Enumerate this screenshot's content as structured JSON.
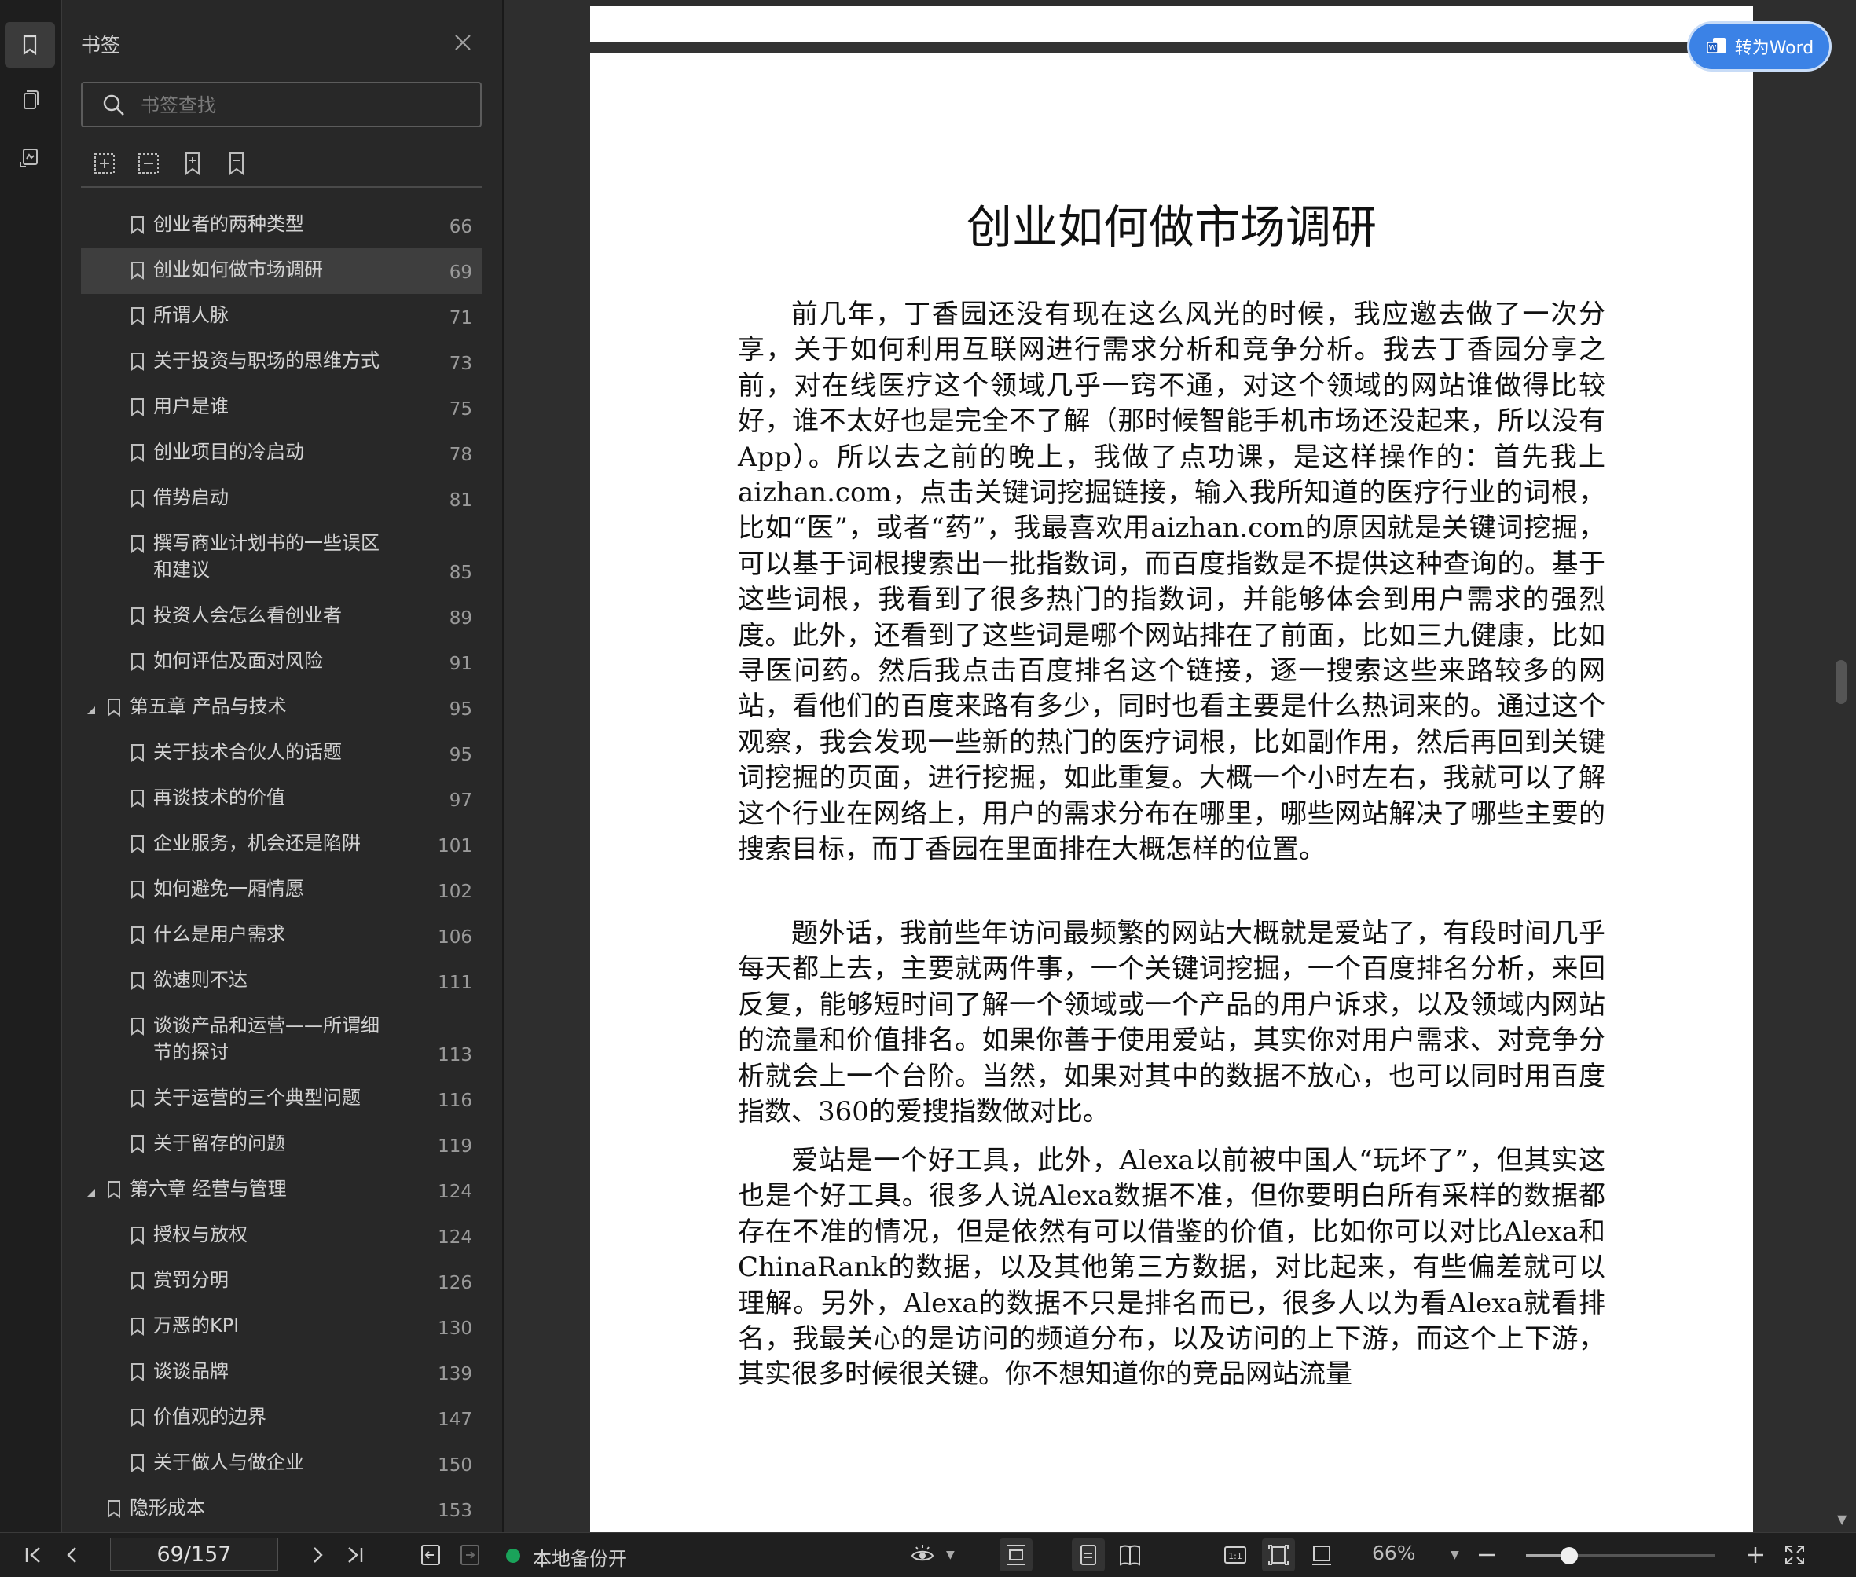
{
  "panel": {
    "title": "书签",
    "search_placeholder": "书签查找"
  },
  "toc": [
    {
      "label": "创业者的两种类型",
      "page": "66",
      "level": 2,
      "lines": 1
    },
    {
      "label": "创业如何做市场调研",
      "page": "69",
      "level": 2,
      "lines": 1,
      "selected": true
    },
    {
      "label": "所谓人脉",
      "page": "71",
      "level": 2,
      "lines": 1
    },
    {
      "label": "关于投资与职场的思维方式",
      "page": "73",
      "level": 2,
      "lines": 1
    },
    {
      "label": "用户是谁",
      "page": "75",
      "level": 2,
      "lines": 1
    },
    {
      "label": "创业项目的冷启动",
      "page": "78",
      "level": 2,
      "lines": 1
    },
    {
      "label": "借势启动",
      "page": "81",
      "level": 2,
      "lines": 1
    },
    {
      "label": "撰写商业计划书的一些误区和建议",
      "page": "85",
      "level": 2,
      "lines": 2
    },
    {
      "label": "投资人会怎么看创业者",
      "page": "89",
      "level": 2,
      "lines": 1
    },
    {
      "label": "如何评估及面对风险",
      "page": "91",
      "level": 2,
      "lines": 1
    },
    {
      "label": "第五章 产品与技术",
      "page": "95",
      "level": 1,
      "lines": 1,
      "expanded": true
    },
    {
      "label": "关于技术合伙人的话题",
      "page": "95",
      "level": 2,
      "lines": 1
    },
    {
      "label": "再谈技术的价值",
      "page": "97",
      "level": 2,
      "lines": 1
    },
    {
      "label": "企业服务，机会还是陷阱",
      "page": "101",
      "level": 2,
      "lines": 1
    },
    {
      "label": "如何避免一厢情愿",
      "page": "102",
      "level": 2,
      "lines": 1
    },
    {
      "label": "什么是用户需求",
      "page": "106",
      "level": 2,
      "lines": 1
    },
    {
      "label": "欲速则不达",
      "page": "111",
      "level": 2,
      "lines": 1
    },
    {
      "label": "谈谈产品和运营——所谓细节的探讨",
      "page": "113",
      "level": 2,
      "lines": 2
    },
    {
      "label": "关于运营的三个典型问题",
      "page": "116",
      "level": 2,
      "lines": 1
    },
    {
      "label": "关于留存的问题",
      "page": "119",
      "level": 2,
      "lines": 1
    },
    {
      "label": "第六章 经营与管理",
      "page": "124",
      "level": 1,
      "lines": 1,
      "expanded": true
    },
    {
      "label": "授权与放权",
      "page": "124",
      "level": 2,
      "lines": 1
    },
    {
      "label": "赏罚分明",
      "page": "126",
      "level": 2,
      "lines": 1
    },
    {
      "label": "万恶的KPI",
      "page": "130",
      "level": 2,
      "lines": 1
    },
    {
      "label": "谈谈品牌",
      "page": "139",
      "level": 2,
      "lines": 1
    },
    {
      "label": "价值观的边界",
      "page": "147",
      "level": 2,
      "lines": 1
    },
    {
      "label": "关于做人与做企业",
      "page": "150",
      "level": 2,
      "lines": 1
    },
    {
      "label": "隐形成本",
      "page": "153",
      "level": 1,
      "lines": 1
    }
  ],
  "document": {
    "title": "创业如何做市场调研",
    "paragraphs": [
      "前几年，丁香园还没有现在这么风光的时候，我应邀去做了一次分享，关于如何利用互联网进行需求分析和竞争分析。我去丁香园分享之前，对在线医疗这个领域几乎一窍不通，对这个领域的网站谁做得比较好，谁不太好也是完全不了解（那时候智能手机市场还没起来，所以没有App）。所以去之前的晚上，我做了点功课，是这样操作的：首先我上aizhan.com，点击关键词挖掘链接，输入我所知道的医疗行业的词根，比如“医”，或者“药”，我最喜欢用aizhan.com的原因就是关键词挖掘，可以基于词根搜索出一批指数词，而百度指数是不提供这种查询的。基于这些词根，我看到了很多热门的指数词，并能够体会到用户需求的强烈度。此外，还看到了这些词是哪个网站排在了前面，比如三九健康，比如寻医问药。然后我点击百度排名这个链接，逐一搜索这些来路较多的网站，看他们的百度来路有多少，同时也看主要是什么热词来的。通过这个观察，我会发现一些新的热门的医疗词根，比如副作用，然后再回到关键词挖掘的页面，进行挖掘，如此重复。大概一个小时左右，我就可以了解这个行业在网络上，用户的需求分布在哪里，哪些网站解决了哪些主要的搜索目标，而丁香园在里面排在大概怎样的位置。",
      "题外话，我前些年访问最频繁的网站大概就是爱站了，有段时间几乎每天都上去，主要就两件事，一个关键词挖掘，一个百度排名分析，来回反复，能够短时间了解一个领域或一个产品的用户诉求，以及领域内网站的流量和价值排名。如果你善于使用爱站，其实你对用户需求、对竞争分析就会上一个台阶。当然，如果对其中的数据不放心，也可以同时用百度指数、360的爱搜指数做对比。",
      "爱站是一个好工具，此外，Alexa以前被中国人“玩坏了”，但其实这也是个好工具。很多人说Alexa数据不准，但你要明白所有采样的数据都存在不准的情况，但是依然有可以借鉴的价值，比如你可以对比Alexa和ChinaRank的数据，以及其他第三方数据，对比起来，有些偏差就可以理解。另外，Alexa的数据不只是排名而已，很多人以为看Alexa就看排名，我最关心的是访问的频道分布，以及访问的上下游，而这个上下游，其实很多时候很关键。你不想知道你的竞品网站流量"
    ]
  },
  "to_word_label": "转为Word",
  "status": {
    "page_indicator": "69/157",
    "backup_label": "本地备份开",
    "zoom_label": "66%",
    "zoom_fraction": 0.23
  }
}
